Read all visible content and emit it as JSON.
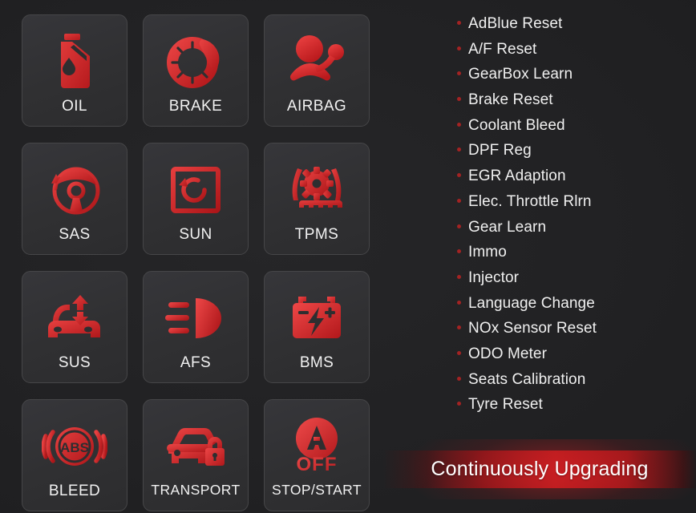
{
  "theme": {
    "background": "#1d1d1f",
    "tile_fill": "#333335",
    "tile_border": "#464648",
    "accent_red": "#d92b2b",
    "bullet_red": "#a32323",
    "banner_red": "#c81f22",
    "text": "#f2f2f2"
  },
  "grid": {
    "tiles": [
      {
        "label": "OIL",
        "icon": "oil-can-icon"
      },
      {
        "label": "BRAKE",
        "icon": "brake-disc-icon"
      },
      {
        "label": "AIRBAG",
        "icon": "airbag-occupant-icon"
      },
      {
        "label": "SAS",
        "icon": "steering-angle-sensor-icon"
      },
      {
        "label": "SUN",
        "icon": "sunroof-reset-icon"
      },
      {
        "label": "TPMS",
        "icon": "tire-pressure-gear-icon"
      },
      {
        "label": "SUS",
        "icon": "suspension-car-arrow-icon"
      },
      {
        "label": "AFS",
        "icon": "adaptive-headlight-icon"
      },
      {
        "label": "BMS",
        "icon": "battery-bolt-icon"
      },
      {
        "label": "BLEED",
        "icon": "abs-bleed-icon"
      },
      {
        "label": "TRANSPORT",
        "icon": "car-lock-icon"
      },
      {
        "label": "STOP/START",
        "icon": "auto-stop-start-off-icon"
      }
    ]
  },
  "features": {
    "items": [
      "AdBlue Reset",
      "A/F Reset",
      "GearBox Learn",
      "Brake Reset",
      "Coolant Bleed",
      "DPF Reg",
      "EGR Adaption",
      "Elec. Throttle Rlrn",
      "Gear Learn",
      "Immo",
      "Injector",
      "Language Change",
      "NOx Sensor Reset",
      "ODO Meter",
      "Seats Calibration",
      "Tyre Reset"
    ]
  },
  "banner": {
    "text": "Continuously Upgrading"
  }
}
